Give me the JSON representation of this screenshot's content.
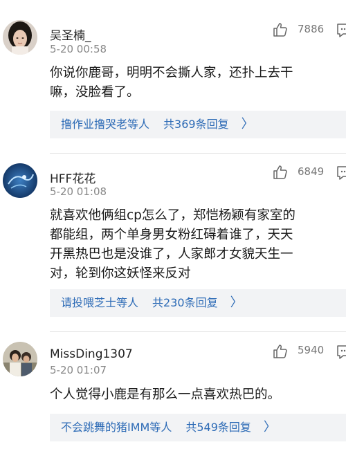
{
  "comments": [
    {
      "username": "吴圣楠_",
      "time": "5-20 00:58",
      "likes": "7886",
      "lines": [
        "你说你鹿哥，明明不会撕人家，还扑上去干",
        "嘛，没脸看了。"
      ],
      "reply_names": "撸作业撸哭老",
      "reply_suffix": "等人",
      "reply_total": "共369条回复",
      "avatar_icon": "girl-portrait-avatar"
    },
    {
      "username": "HFF花花",
      "time": "5-20 01:08",
      "likes": "6849",
      "lines": [
        "就喜欢他俩组cp怎么了，郑恺杨颖有家室的",
        "都能组，两个单身男女粉红碍着谁了，天天",
        "开黑热巴也是没谁了，人家郎才女貌天生一",
        "对，轮到你这妖怪来反对"
      ],
      "reply_names": "请投喂芝士",
      "reply_suffix": "等人",
      "reply_total": "共230条回复",
      "avatar_icon": "blue-swirl-avatar"
    },
    {
      "username": "MissDing1307",
      "time": "5-20 01:07",
      "likes": "5940",
      "lines": [
        "个人觉得小鹿是有那么一点喜欢热巴的。"
      ],
      "reply_names": "不会跳舞的猪IMM",
      "reply_suffix": "等人",
      "reply_total": "共549条回复",
      "avatar_icon": "couple-photo-avatar"
    }
  ],
  "chevron": "〉"
}
